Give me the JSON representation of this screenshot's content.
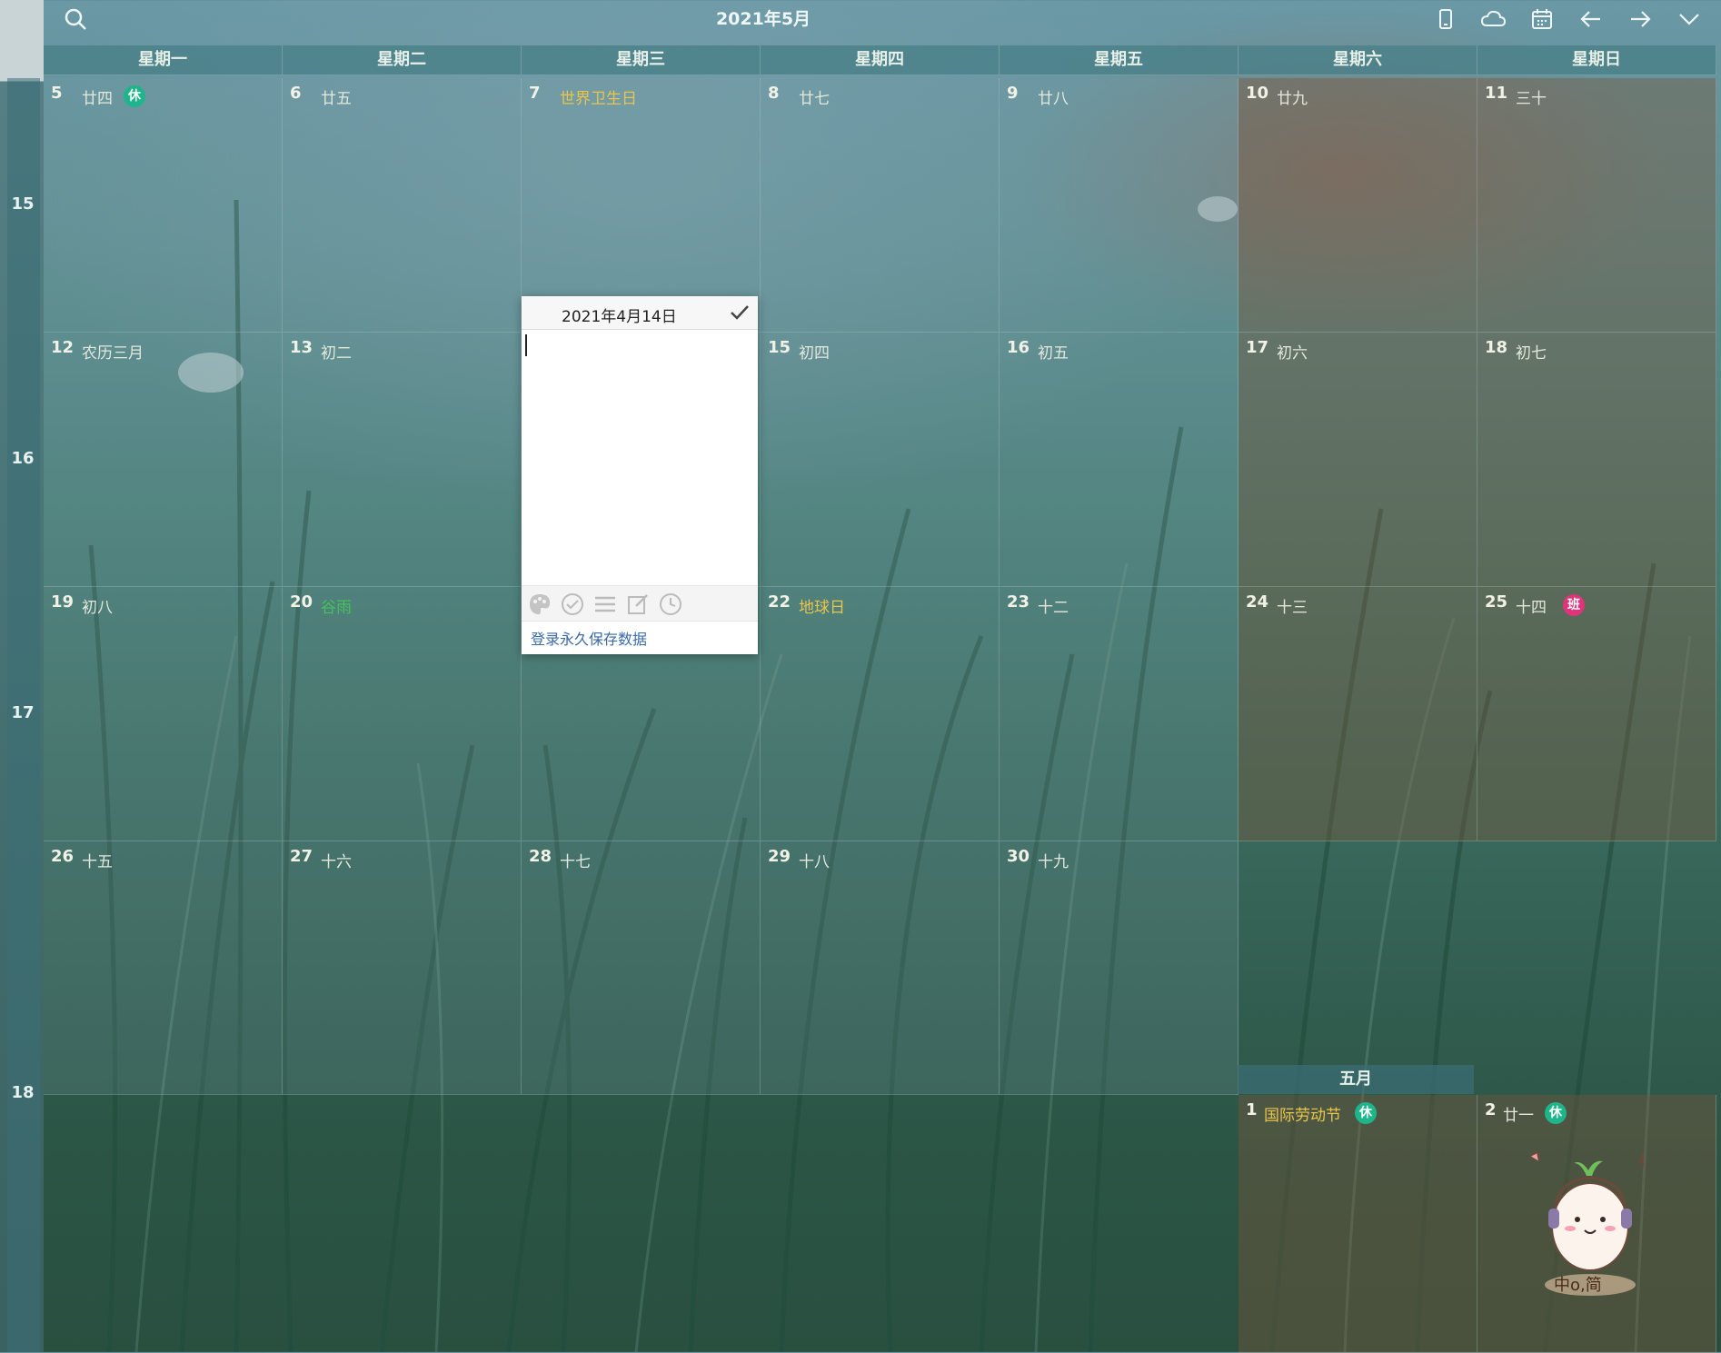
{
  "header": {
    "title": "2021年5月",
    "icons": [
      "search-icon",
      "phone-icon",
      "cloud-icon",
      "calendar-icon",
      "arrow-left-icon",
      "arrow-right-icon",
      "chevron-down-icon"
    ]
  },
  "weekdays": [
    "星期一",
    "星期二",
    "星期三",
    "星期四",
    "星期五",
    "星期六",
    "星期日"
  ],
  "week_numbers": [
    "15",
    "16",
    "17",
    "18"
  ],
  "weeks": [
    [
      {
        "day": "5",
        "lunar": "廿四",
        "badge": "休"
      },
      {
        "day": "6",
        "lunar": "廿五"
      },
      {
        "day": "7",
        "lunar": "世界卫生日",
        "highlight": "yellow"
      },
      {
        "day": "8",
        "lunar": "廿七"
      },
      {
        "day": "9",
        "lunar": "廿八"
      },
      {
        "day": "10",
        "lunar": "廿九"
      },
      {
        "day": "11",
        "lunar": "三十"
      }
    ],
    [
      {
        "day": "12",
        "lunar": "农历三月"
      },
      {
        "day": "13",
        "lunar": "初二"
      },
      {
        "day": "",
        "lunar": ""
      },
      {
        "day": "15",
        "lunar": "初四"
      },
      {
        "day": "16",
        "lunar": "初五"
      },
      {
        "day": "17",
        "lunar": "初六"
      },
      {
        "day": "18",
        "lunar": "初七"
      }
    ],
    [
      {
        "day": "19",
        "lunar": "初八"
      },
      {
        "day": "20",
        "lunar": "谷雨",
        "highlight": "green"
      },
      {
        "day": "",
        "lunar": ""
      },
      {
        "day": "22",
        "lunar": "地球日",
        "highlight": "yellow"
      },
      {
        "day": "23",
        "lunar": "十二"
      },
      {
        "day": "24",
        "lunar": "十三"
      },
      {
        "day": "25",
        "lunar": "十四",
        "badge": "班"
      }
    ],
    [
      {
        "day": "26",
        "lunar": "十五"
      },
      {
        "day": "27",
        "lunar": "十六"
      },
      {
        "day": "28",
        "lunar": "十七"
      },
      {
        "day": "29",
        "lunar": "十八"
      },
      {
        "day": "30",
        "lunar": "十九"
      }
    ]
  ],
  "next_month": {
    "label": "五月",
    "days": [
      {
        "day": "1",
        "lunar": "国际劳动节",
        "highlight": "yellow",
        "badge": "休"
      },
      {
        "day": "2",
        "lunar": "廿一",
        "badge": "休"
      }
    ]
  },
  "popup": {
    "date": "2021年4月14日",
    "login_text": "登录永久保存数据",
    "tools": [
      "palette-icon",
      "check-circle-icon",
      "list-icon",
      "edit-icon",
      "clock-icon"
    ]
  },
  "mascot_text": "中o,简"
}
